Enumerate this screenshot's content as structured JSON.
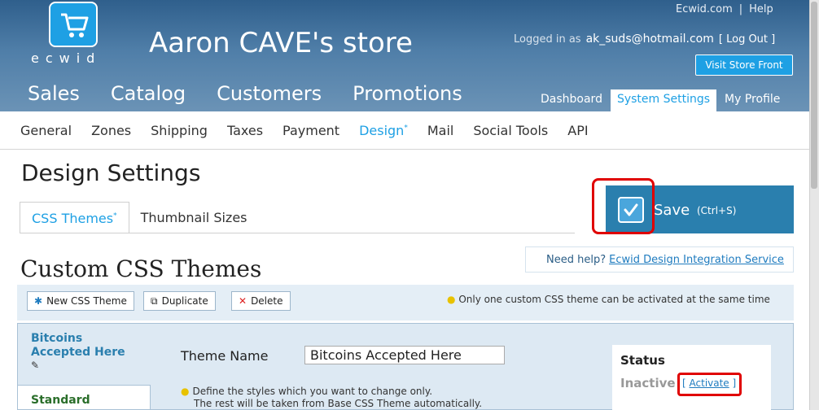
{
  "header": {
    "logo_text": "ecwid",
    "store_title": "Aaron CAVE's store",
    "top_links": [
      "Ecwid.com",
      "Help"
    ],
    "logged_in_label": "Logged in as",
    "user_email": "ak_suds@hotmail.com",
    "logout": "[ Log Out ]",
    "visit_store": "Visit Store Front",
    "main_nav": [
      "Sales",
      "Catalog",
      "Customers",
      "Promotions"
    ],
    "sub_nav": [
      "Dashboard",
      "System Settings",
      "My Profile"
    ]
  },
  "settings_nav": {
    "items": [
      "General",
      "Zones",
      "Shipping",
      "Taxes",
      "Payment",
      "Design",
      "Mail",
      "Social Tools",
      "API"
    ],
    "active": "Design",
    "active_marker": "*"
  },
  "page": {
    "title": "Design Settings",
    "tabs": [
      "CSS Themes",
      "Thumbnail Sizes"
    ],
    "tab_marker": "*",
    "save_label": "Save",
    "save_hint": "(Ctrl+S)"
  },
  "themes": {
    "section_title": "Custom CSS Themes",
    "help_text": "Need help?",
    "help_link": "Ecwid Design Integration Service",
    "toolbar": {
      "new": "New CSS Theme",
      "duplicate": "Duplicate",
      "delete": "Delete",
      "note": "Only one custom CSS theme can be activated at the same time"
    },
    "list": {
      "selected_line1": "Bitcoins",
      "selected_line2": "Accepted Here",
      "other": "Standard"
    },
    "theme_name_label": "Theme Name",
    "theme_name_value": "Bitcoins Accepted Here",
    "define_note_1": "Define the styles which you want to change only.",
    "define_note_2": "The rest will be taken from Base CSS Theme automatically.",
    "status_title": "Status",
    "status_value": "Inactive",
    "activate_open": "[",
    "activate": "Activate",
    "activate_close": "]"
  },
  "colors": {
    "accent": "#1ea0e4",
    "save_bg": "#2a7fae",
    "highlight": "#e00000"
  }
}
